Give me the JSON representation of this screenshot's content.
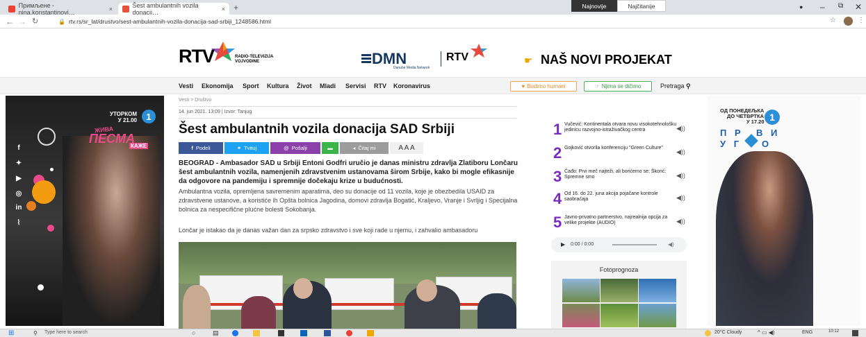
{
  "browser": {
    "tabs": [
      {
        "label": "Примљене - nina.konstantinovi…",
        "close": "×"
      },
      {
        "label": "Šest ambulantnih vozila donacij…",
        "close": "×"
      }
    ],
    "new_tab": "+",
    "url": "rtv.rs/sr_lat/drustvo/sest-ambulantnih-vozila-donacija-sad-srbiji_1248586.html"
  },
  "header": {
    "rtv_logo": "RTV",
    "rtv_sub": "RADIO-TELEVIZIJA\nVOJVODINE",
    "dmn_logo": "DMN",
    "dmn_sub": "Danube Media Network",
    "rtv2_logo": "RTV",
    "project": "NAŠ NOVI PROJEKAT"
  },
  "nav": {
    "items": [
      "Vesti",
      "Ekonomija",
      "Sport",
      "Kultura",
      "Život",
      "Mladi",
      "Servisi",
      "RTV",
      "Koronavirus"
    ],
    "btn1": "Budimo humani",
    "btn2": "Njima se dičimo",
    "search": "Pretraga"
  },
  "ad_left": {
    "line1": "УТОРКОМ",
    "line2": "У 21.00",
    "show": "ПЕСМА",
    "show_top": "ЖИВА",
    "show_sub": "КАЖЕ"
  },
  "ad_right": {
    "line1": "ОД ПОНЕДЕЉКА",
    "line2": "ДО ЧЕТВРТКА",
    "line3": "У 17.20",
    "logo_a": "П Р",
    "logo_b": "В И",
    "logo_c": "У Г",
    "logo_d": "О"
  },
  "article": {
    "breadcrumb": "Vesti > Društvo",
    "meta": "14. jun 2021. 13:09 | Izvor: Tanjug",
    "title": "Šest ambulantnih vozila donacija SAD Srbiji",
    "share": [
      "Podeli",
      "Tvituj",
      "Pošalji",
      "",
      "Čitaj mi"
    ],
    "font_sizes": "A A A",
    "lead": "BEOGRAD - Ambasador SAD u Srbiji Entoni Godfri uručio je danas ministru zdravlja Zlatiboru Lončaru šest ambulantnih vozila, namenjenih zdravstvenim ustanovama širom Srbije, kako bi mogle efikasnije da odgovore na pandemiju i spremnije dočekaju krize u budućnosti.",
    "body1": "Ambulantna vozila, opremljena savremenim aparatima, deo su donacije od 11 vozila, koje je obezbedila USAID za zdravstvene ustanove, a koristiće ih Opšta bolnica Jagodina, domovi zdravlja Bogatić, Kraljevo, Vranje i Svrljig i Specijalna bolnica za nespecifične plućne bolesti Sokobanja.",
    "body2": "Lončar je istakao da je danas važan dan za srpsko zdravstvo i sve koji rade u njemu, i zahvalio ambasadoru"
  },
  "sidebar": {
    "tab_latest": "Najnovije",
    "tab_read": "Najčitanije",
    "items": [
      {
        "num": "1",
        "text": "Vučević: Kontinentala otvara novu visokotehnološku jedinicu razvojno-istraživačkog centra"
      },
      {
        "num": "2",
        "text": "Gojković otvorila konferenciju \"Green Culture\""
      },
      {
        "num": "3",
        "text": "Čađo: Prvi meč najteži, ali borićemo se; Škorić: Spremne smo"
      },
      {
        "num": "4",
        "text": "Od 16. do 22. juna akcija pojačane kontrole saobraćaja"
      },
      {
        "num": "5",
        "text": "Javno-privatno partnerstvo, najrealnija opcija za velike projekte (AUDIO)"
      }
    ],
    "player_time": "0:00 / 0:00",
    "foto_title": "Fotoprognoza"
  },
  "taskbar": {
    "search": "Type here to search",
    "weather": "20°C Cloudy",
    "lang": "ENG",
    "time": "10:12"
  },
  "colors": {
    "facebook": "#3b5998",
    "twitter": "#1da1f2",
    "email": "#8b3fa8",
    "sms": "#3bb44a",
    "listen": "#9c9c9c",
    "accent_purple": "#7a2bbf"
  }
}
